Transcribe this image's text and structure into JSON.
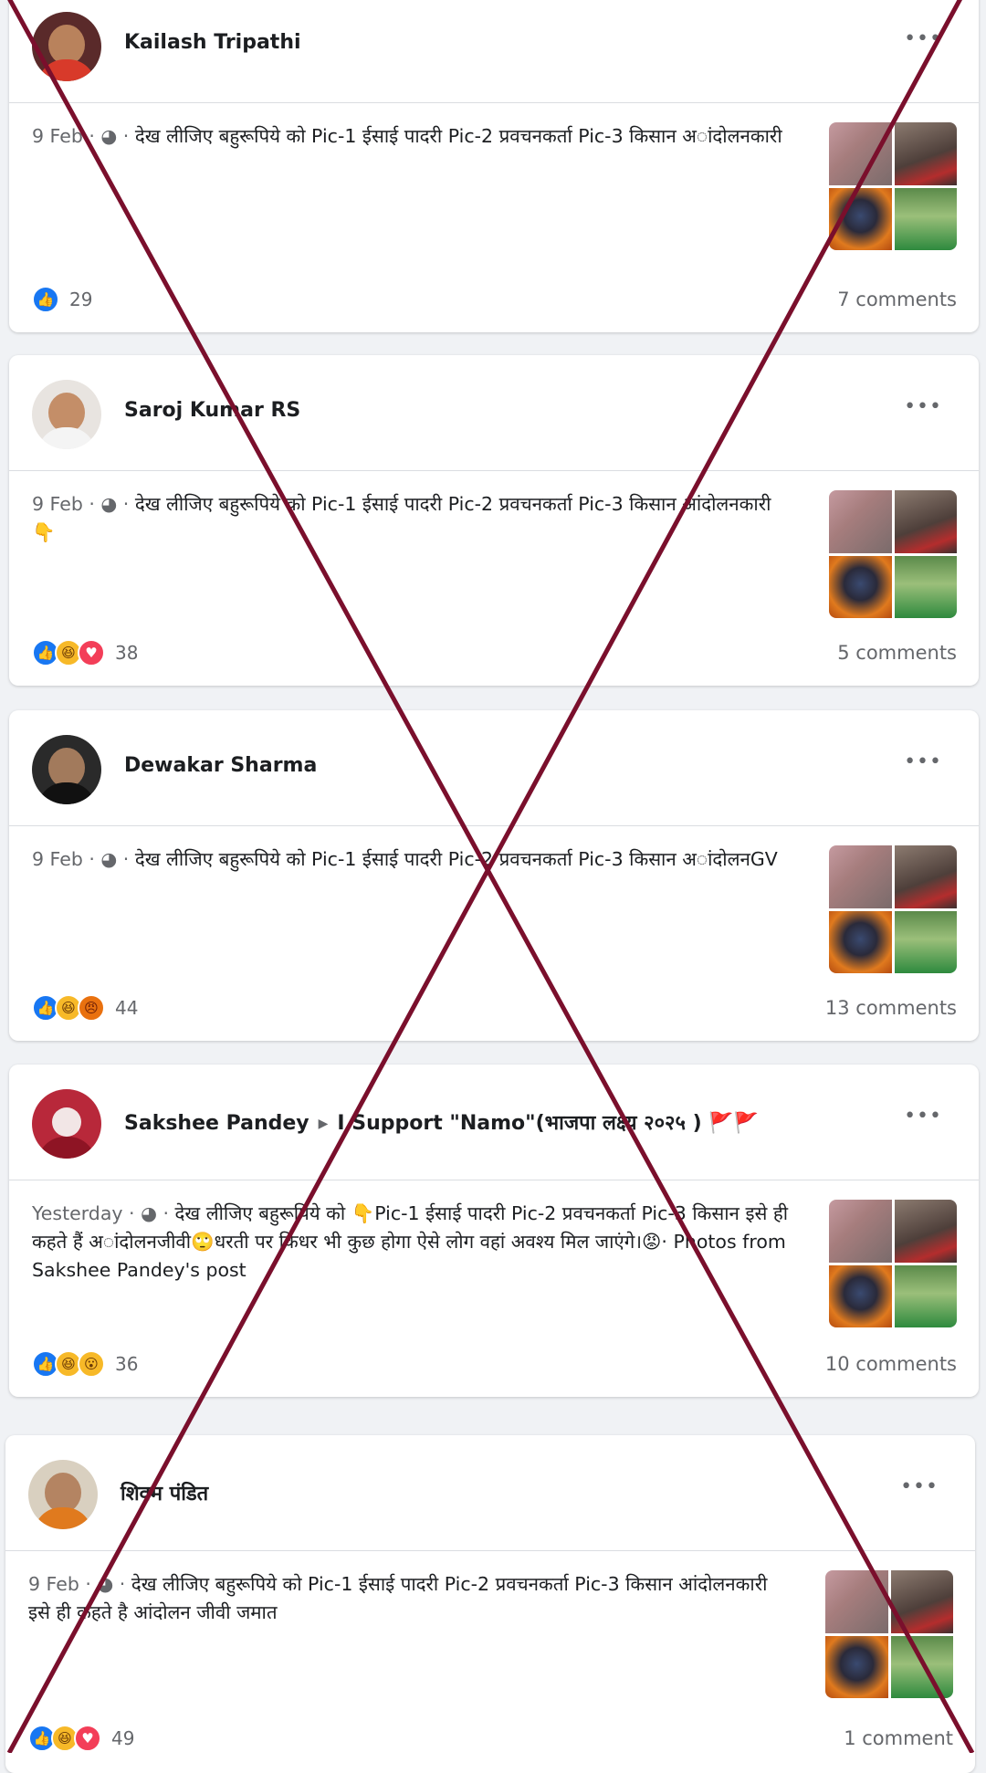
{
  "posts": [
    {
      "author": "Kailash Tripathi",
      "timestamp": "9 Feb",
      "text": "देख लीजिए बहुरूपिये को Pic-1 ईसाई पादरी Pic-2 प्रवचनकर्ता Pic-3 किसान अांदोलनकारी",
      "reaction_count": "29",
      "comments": "7 comments",
      "reactions": [
        "like"
      ]
    },
    {
      "author": "Saroj Kumar RS",
      "timestamp": "9 Feb",
      "text": "देख लीजिए बहुरूपिये को Pic-1 ईसाई पादरी Pic-2 प्रवचनकर्ता Pic-3 किसान आंदोलनकारी 👇",
      "reaction_count": "38",
      "comments": "5 comments",
      "reactions": [
        "like",
        "haha",
        "love"
      ]
    },
    {
      "author": "Dewakar Sharma",
      "timestamp": "9 Feb",
      "text": "देख लीजिए बहुरूपिये को Pic-1 ईसाई पादरी Pic-2 प्रवचनकर्ता Pic-3 किसान अांदोलनGV",
      "reaction_count": "44",
      "comments": "13 comments",
      "reactions": [
        "like",
        "haha",
        "angry"
      ]
    },
    {
      "author": "Sakshee Pandey",
      "group": "I Support \"Namo\"(भाजपा लक्ष्य २०२५ ) 🚩🚩",
      "timestamp": "Yesterday",
      "text": "देख लीजिए बहुरूपिये को 👇Pic-1 ईसाई पादरी Pic-2 प्रवचनकर्ता Pic-3 किसान इसे ही कहते हैं अांदोलनजीवी🙄धरती पर किधर भी कुछ होगा ऐसे लोग वहां अवश्य मिल जाएंगे।😡· Photos from Sakshee Pandey's post",
      "reaction_count": "36",
      "comments": "10 comments",
      "reactions": [
        "like",
        "haha",
        "wow"
      ]
    },
    {
      "author": "शिवम पंडित",
      "timestamp": "9 Feb",
      "text": "देख लीजिए बहुरूपिये को Pic-1 ईसाई पादरी Pic-2 प्रवचनकर्ता Pic-3 किसान आंदोलनकारी इसे ही कहते है आंदोलन जीवी जमात",
      "reaction_count": "49",
      "comments": "1 comment",
      "reactions": [
        "like",
        "haha",
        "love"
      ]
    }
  ],
  "meta_separator": " · ◕ · ",
  "more_label": "•••",
  "colors": {
    "cross": "#7a0f2c",
    "like": "#1877f2",
    "love": "#f33e58",
    "haha": "#f7b928"
  }
}
